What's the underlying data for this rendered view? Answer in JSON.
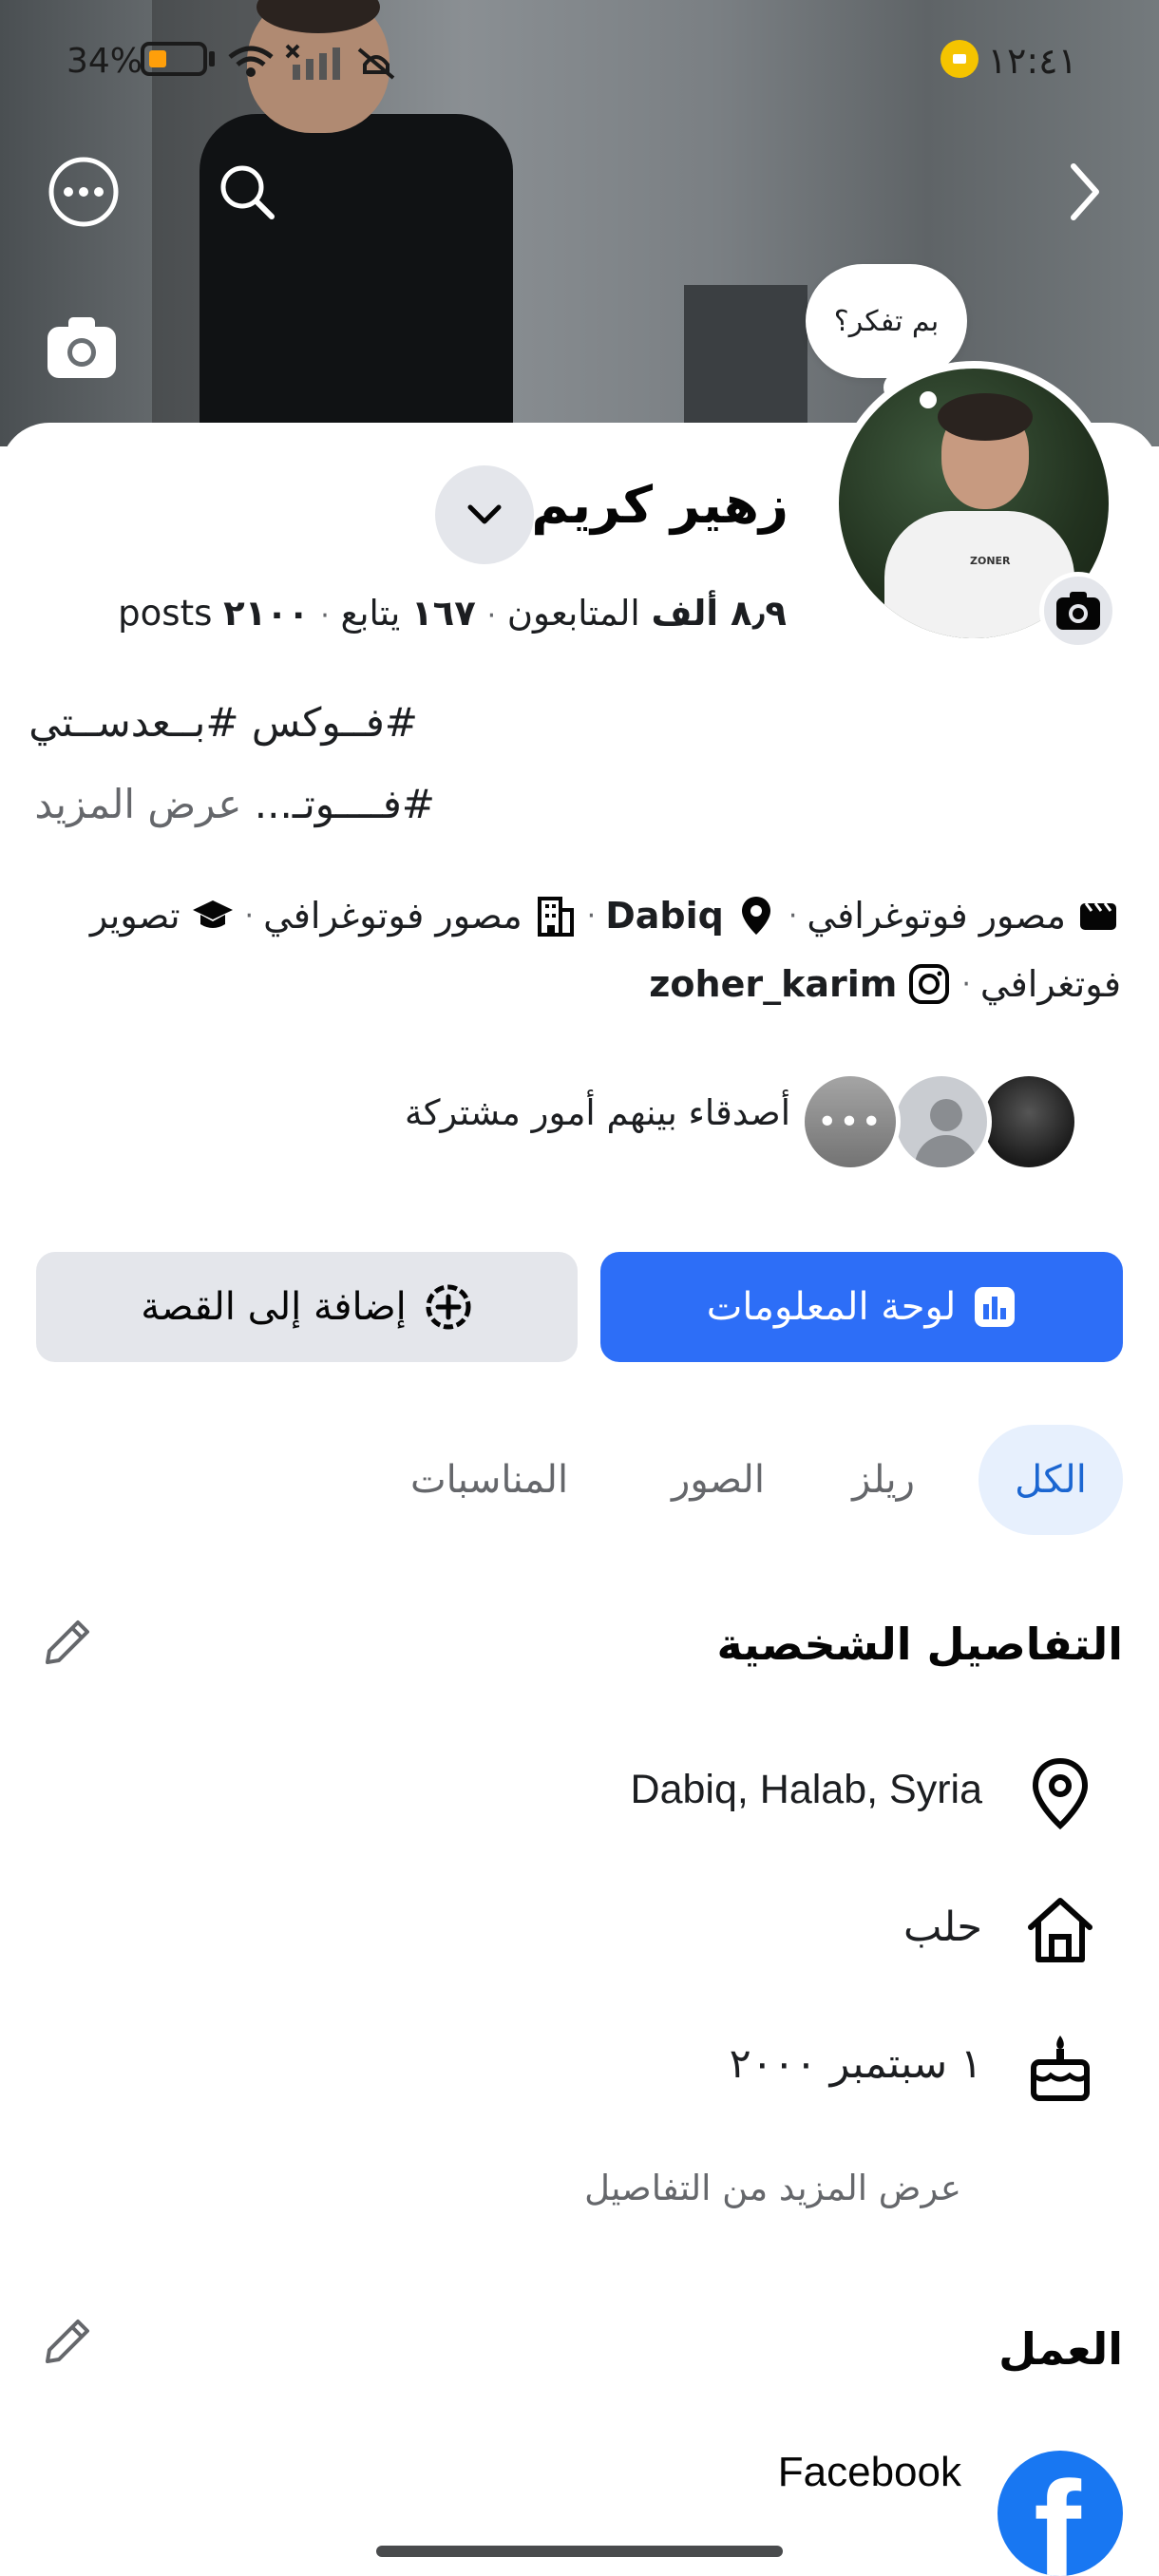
{
  "status_bar": {
    "battery_percent": "34%",
    "time": "١٢:٤١"
  },
  "profile": {
    "thought_bubble": "بم تفكر؟",
    "name": "زهير كريم",
    "stats": {
      "followers_value": "٨٫٩ ألف",
      "followers_label": "المتابعون",
      "following_value": "١٦٧",
      "following_label": "يتابع",
      "posts_value": "٢١٠٠",
      "posts_label": "posts"
    },
    "bio_line1": "#فــوكس #بــعدســتي",
    "bio_line2": "#فــــوتـ...",
    "bio_see_more": "عرض المزيد"
  },
  "intro": {
    "items": [
      {
        "icon": "video-icon",
        "text": "مصور فوتوغرافي"
      },
      {
        "icon": "location-pin-icon",
        "text": "Dabiq",
        "bold": true
      },
      {
        "icon": "building-icon",
        "text": "مصور فوتوغرافي"
      },
      {
        "icon": "graduation-cap-icon",
        "text": "تصوير"
      }
    ],
    "line2": [
      {
        "text": "فوتغرافي"
      },
      {
        "icon": "instagram-icon",
        "text": "zoher_karim",
        "bold": true
      }
    ]
  },
  "mutual_friends": {
    "text": "أصدقاء بينهم أمور مشتركة"
  },
  "actions": {
    "dashboard": "لوحة المعلومات",
    "add_story": "إضافة إلى القصة"
  },
  "tabs": [
    {
      "label": "الكل",
      "active": true
    },
    {
      "label": "ريلز"
    },
    {
      "label": "الصور"
    },
    {
      "label": "المناسبات"
    }
  ],
  "personal_details": {
    "title": "التفاصيل الشخصية",
    "location": "Dabiq, Halab, Syria",
    "hometown": "حلب",
    "birthday": "١ سبتمبر ٢٠٠٠",
    "see_more": "عرض المزيد من التفاصيل"
  },
  "work": {
    "title": "العمل",
    "employer": "Facebook"
  },
  "colors": {
    "primary": "#2d6ef7",
    "tab_active_bg": "#e7f0fd",
    "tab_active_text": "#1b66d1",
    "secondary_bg": "#e4e6eb",
    "muted_text": "#65676b"
  }
}
